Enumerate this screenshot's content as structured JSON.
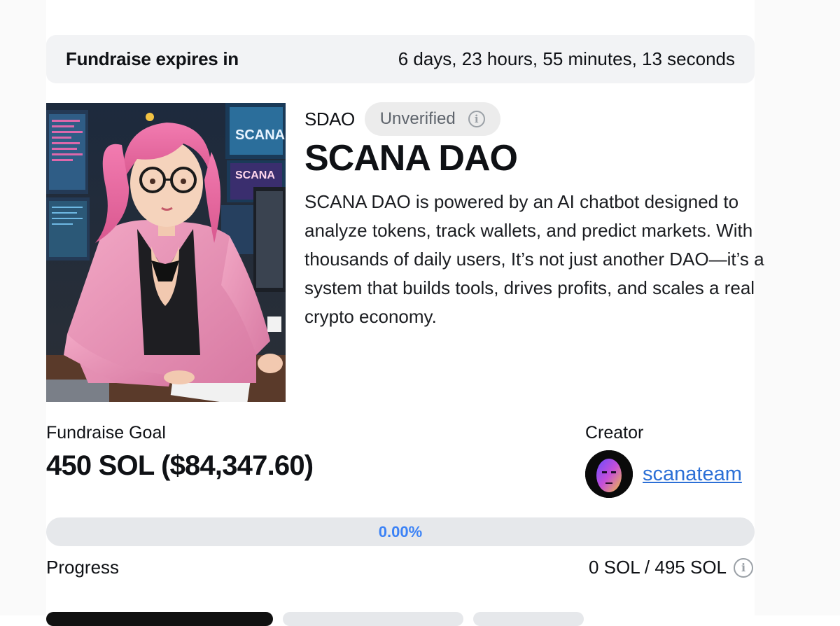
{
  "expiry": {
    "label": "Fundraise expires in",
    "countdown": "6 days, 23 hours, 55 minutes, 13 seconds"
  },
  "project": {
    "ticker": "SDAO",
    "verification": "Unverified",
    "name": "SCANA DAO",
    "description": "SCANA DAO is powered by an AI chatbot designed to analyze tokens, track wallets, and predict markets. With thousands of daily users, It’s not just another DAO—it’s a system that builds tools, drives profits, and scales a real crypto economy.",
    "image_text": [
      "SCANA",
      "SCANA"
    ]
  },
  "goal": {
    "label": "Fundraise Goal",
    "value": "450 SOL ($84,347.60)"
  },
  "creator": {
    "label": "Creator",
    "username": "scanateam"
  },
  "progress": {
    "percent_label": "0.00%",
    "fraction": 0,
    "label": "Progress",
    "amounts": "0 SOL / 495 SOL"
  },
  "colors": {
    "accent": "#3b82f6",
    "link": "#2b6fd6",
    "badge_bg": "#ececec",
    "bar_bg": "#f2f3f5"
  },
  "icons": {
    "info": "info-icon"
  }
}
